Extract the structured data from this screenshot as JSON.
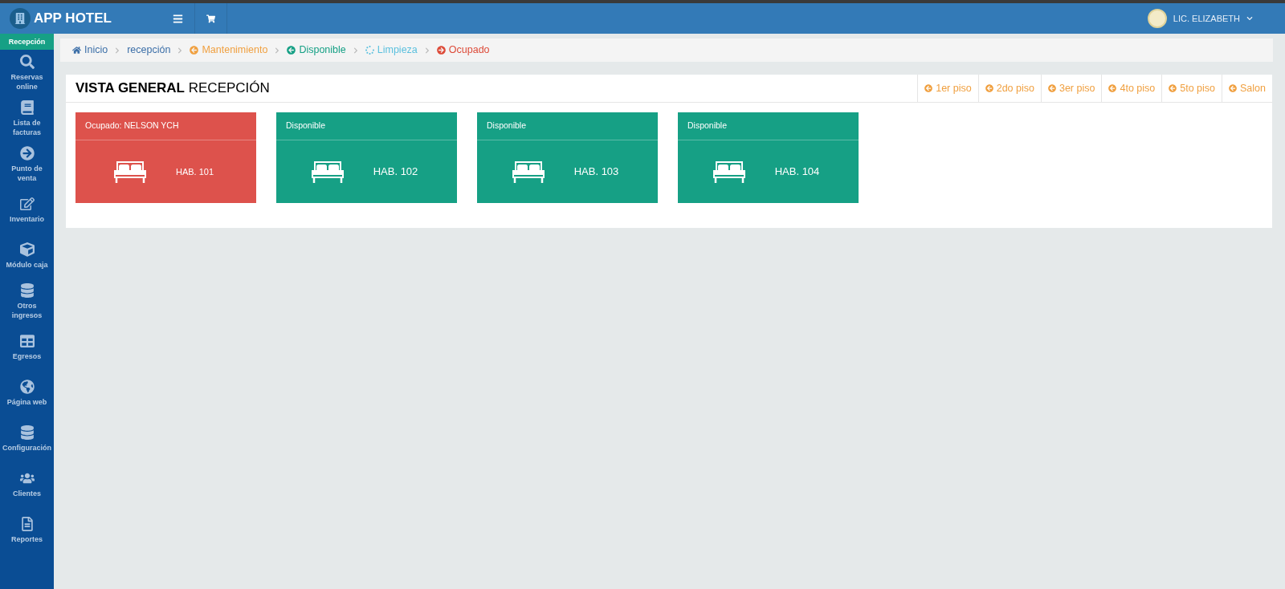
{
  "header": {
    "brand": "APP HOTEL",
    "user": "LIC. ELIZABETH"
  },
  "sidebar": {
    "items": [
      {
        "label": "Recepción",
        "selected": true
      },
      {
        "label": "Reservas online",
        "selected": false
      },
      {
        "label": "Lista de facturas",
        "selected": false
      },
      {
        "label": "Punto de venta",
        "selected": false
      },
      {
        "label": "Inventario",
        "selected": false
      },
      {
        "label": "Módulo caja",
        "selected": false
      },
      {
        "label": "Otros ingresos",
        "selected": false
      },
      {
        "label": "Egresos",
        "selected": false
      },
      {
        "label": "Página web",
        "selected": false
      },
      {
        "label": "Configuración",
        "selected": false
      },
      {
        "label": "Clientes",
        "selected": false
      },
      {
        "label": "Reportes",
        "selected": false
      }
    ]
  },
  "breadcrumb": [
    {
      "label": "Inicio",
      "kind": "home"
    },
    {
      "label": "recepción",
      "kind": "plain"
    },
    {
      "label": "Mantenimiento",
      "kind": "maintenance"
    },
    {
      "label": "Disponible",
      "kind": "available"
    },
    {
      "label": "Limpieza",
      "kind": "cleaning"
    },
    {
      "label": "Ocupado",
      "kind": "occupied"
    }
  ],
  "panel": {
    "title_bold": "VISTA GENERAL",
    "title": "RECEPCIÓN",
    "floors": [
      "1er piso",
      "2do piso",
      "3er piso",
      "4to piso",
      "5to piso",
      "Salon"
    ],
    "rooms": [
      {
        "kind": "occupied",
        "label": "Ocupado: NELSON YCH",
        "room": "HAB. 101"
      },
      {
        "kind": "available",
        "label": "Disponible",
        "room": "HAB. 102"
      },
      {
        "kind": "available",
        "label": "Disponible",
        "room": "HAB. 103"
      },
      {
        "kind": "available",
        "label": "Disponible",
        "room": "HAB. 104"
      }
    ]
  }
}
